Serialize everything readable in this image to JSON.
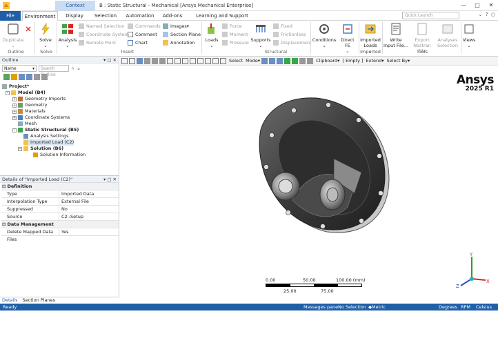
{
  "title": {
    "context_tab": "Context",
    "window_title": "B : Static Structural - Mechanical [Ansys Mechanical Enterprise]"
  },
  "ribbon_tabs": [
    "File",
    "Environment",
    "Display",
    "Selection",
    "Automation",
    "Add-ons",
    "Learning and Support"
  ],
  "quick_launch": {
    "placeholder": "Quick Launch"
  },
  "ribbon": {
    "outline_group": {
      "label": "Outline",
      "duplicate": "Duplicate"
    },
    "solve_group": {
      "label": "Solve",
      "solve": "Solve"
    },
    "insert_group": {
      "label": "Insert",
      "analysis": "Analysis",
      "named_selection": "Named Selection",
      "coordinate_system": "Coordinate System",
      "remote_point": "Remote Point",
      "commands": "Commands",
      "comment": "Comment",
      "chart": "Chart",
      "images": "Images",
      "section_plane": "Section Plane",
      "annotation": "Annotation"
    },
    "loads": "Loads",
    "force": "Force",
    "moment": "Moment",
    "pressure": "Pressure",
    "supports": "Supports",
    "fixed": "Fixed",
    "frictionless": "Frictionless",
    "displacement": "Displacement",
    "structural_group": "Structural",
    "conditions": "Conditions",
    "direct_fe": "Direct FE",
    "imported_loads": "Imported Loads",
    "imported_group": "Imported",
    "write_input_file": "Write Input File...",
    "export_nastran": "Export Nastran File",
    "analyses_selection": "Analyses Selection",
    "tools_group": "Tools",
    "views": "Views"
  },
  "outline": {
    "title": "Outline",
    "name_dropdown": "Name",
    "search_placeholder": "Search Outline",
    "nodes": [
      {
        "label": "Project*"
      },
      {
        "label": "Model (B4)"
      },
      {
        "label": "Geometry Imports"
      },
      {
        "label": "Geometry"
      },
      {
        "label": "Materials"
      },
      {
        "label": "Coordinate Systems"
      },
      {
        "label": "Mesh"
      },
      {
        "label": "Static Structural (B5)"
      },
      {
        "label": "Analysis Settings"
      },
      {
        "label": "Imported Load (C2)"
      },
      {
        "label": "Solution (B6)"
      },
      {
        "label": "Solution Information"
      }
    ]
  },
  "details": {
    "title": "Details of \"Imported Load (C2)\"",
    "sections": [
      {
        "name": "Definition",
        "rows": [
          [
            "Type",
            "Imported Data"
          ],
          [
            "Interpolation Type",
            "External File"
          ],
          [
            "Suppressed",
            "No"
          ],
          [
            "Source",
            "C2::Setup"
          ]
        ]
      },
      {
        "name": "Data Management",
        "rows": [
          [
            "Delete Mapped Data Files",
            "Yes"
          ]
        ]
      }
    ]
  },
  "bottom_tabs": [
    "Details",
    "Section Planes"
  ],
  "graphics_toolbar": {
    "select": "Select",
    "mode": "Mode",
    "clipboard": "Clipboard",
    "empty": "[ Empty ]",
    "extend": "Extend",
    "select_by": "Select By"
  },
  "logo": {
    "brand": "Ansys",
    "version": "2025 R1"
  },
  "scale": {
    "top": [
      "0.00",
      "50.00",
      "100.00 (mm)"
    ],
    "bottom": [
      "25.00",
      "75.00"
    ]
  },
  "triad": {
    "x": "X",
    "y": "Y",
    "z": "Z"
  },
  "status": {
    "ready": "Ready",
    "messages": "Messages pane",
    "selection": "No Selection",
    "units": "Metric (mm, kg, N, s, mV, mA)",
    "angle": "Degrees",
    "speed": "RPM",
    "temp": "Celsius"
  },
  "colors": {
    "accent": "#1f5fa8",
    "context_tab_bg": "#c9dcf2"
  }
}
